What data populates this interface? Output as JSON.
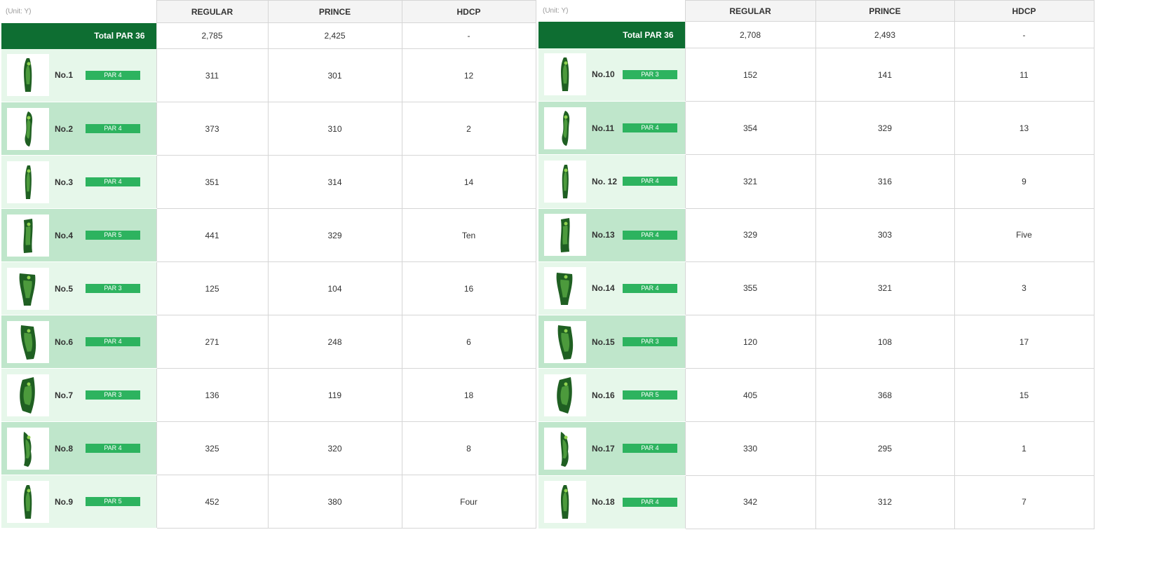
{
  "unit_label": "(Unit: Y)",
  "columns": [
    "REGULAR",
    "PRINCE",
    "HDCP"
  ],
  "front": {
    "total_label": "Total PAR 36",
    "total": {
      "regular": "2,785",
      "prince": "2,425",
      "hdcp": "-"
    },
    "holes": [
      {
        "no": "No.1",
        "par": "PAR 4",
        "regular": "311",
        "prince": "301",
        "hdcp": "12"
      },
      {
        "no": "No.2",
        "par": "PAR 4",
        "regular": "373",
        "prince": "310",
        "hdcp": "2"
      },
      {
        "no": "No.3",
        "par": "PAR 4",
        "regular": "351",
        "prince": "314",
        "hdcp": "14"
      },
      {
        "no": "No.4",
        "par": "PAR 5",
        "regular": "441",
        "prince": "329",
        "hdcp": "Ten"
      },
      {
        "no": "No.5",
        "par": "PAR 3",
        "regular": "125",
        "prince": "104",
        "hdcp": "16"
      },
      {
        "no": "No.6",
        "par": "PAR 4",
        "regular": "271",
        "prince": "248",
        "hdcp": "6"
      },
      {
        "no": "No.7",
        "par": "PAR 3",
        "regular": "136",
        "prince": "119",
        "hdcp": "18"
      },
      {
        "no": "No.8",
        "par": "PAR 4",
        "regular": "325",
        "prince": "320",
        "hdcp": "8"
      },
      {
        "no": "No.9",
        "par": "PAR 5",
        "regular": "452",
        "prince": "380",
        "hdcp": "Four"
      }
    ]
  },
  "back": {
    "total_label": "Total PAR 36",
    "total": {
      "regular": "2,708",
      "prince": "2,493",
      "hdcp": "-"
    },
    "holes": [
      {
        "no": "No.10",
        "par": "PAR 3",
        "regular": "152",
        "prince": "141",
        "hdcp": "11"
      },
      {
        "no": "No.11",
        "par": "PAR 4",
        "regular": "354",
        "prince": "329",
        "hdcp": "13"
      },
      {
        "no": "No. 12",
        "par": "PAR 4",
        "regular": "321",
        "prince": "316",
        "hdcp": "9"
      },
      {
        "no": "No.13",
        "par": "PAR 4",
        "regular": "329",
        "prince": "303",
        "hdcp": "Five"
      },
      {
        "no": "No.14",
        "par": "PAR 4",
        "regular": "355",
        "prince": "321",
        "hdcp": "3"
      },
      {
        "no": "No.15",
        "par": "PAR 3",
        "regular": "120",
        "prince": "108",
        "hdcp": "17"
      },
      {
        "no": "No.16",
        "par": "PAR 5",
        "regular": "405",
        "prince": "368",
        "hdcp": "15"
      },
      {
        "no": "No.17",
        "par": "PAR 4",
        "regular": "330",
        "prince": "295",
        "hdcp": "1"
      },
      {
        "no": "No.18",
        "par": "PAR 4",
        "regular": "342",
        "prince": "312",
        "hdcp": "7"
      }
    ]
  },
  "colors": {
    "header_green": "#0e6e32",
    "par_badge": "#2db35f",
    "row_light": "#e6f7ea",
    "row_dark": "#bfe6cb"
  }
}
